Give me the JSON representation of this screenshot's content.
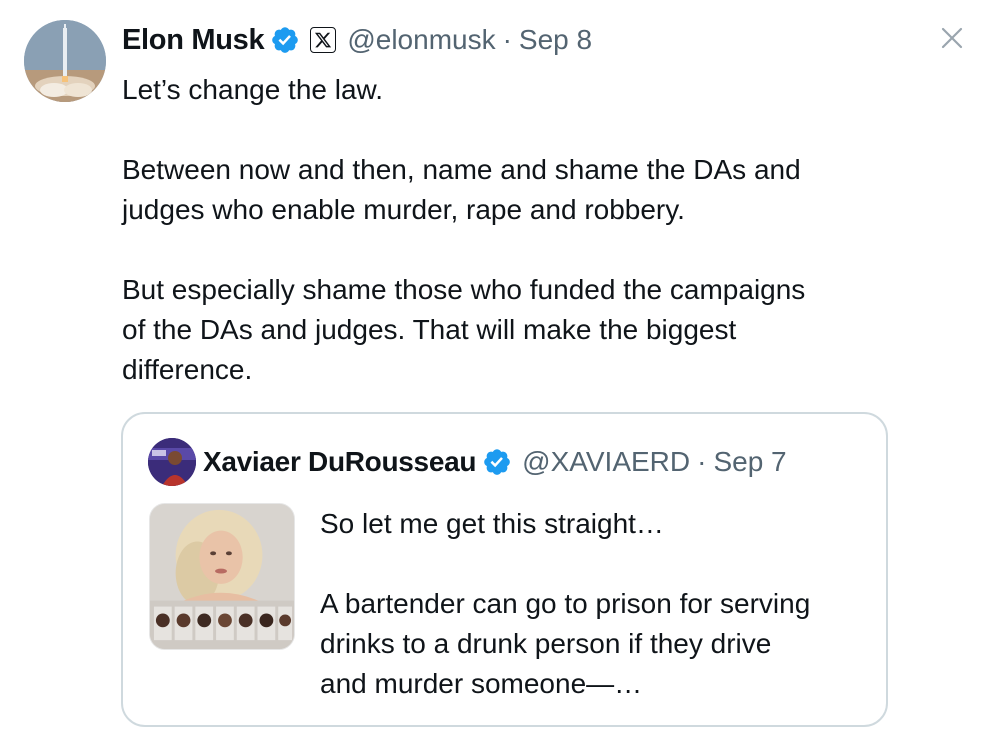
{
  "tweet": {
    "author": {
      "name": "Elon Musk",
      "handle": "@elonmusk",
      "separator": "·",
      "date": "Sep 8",
      "avatar_icon": "rocket-launch-avatar",
      "verified_icon": "verified-badge-icon",
      "affiliation_icon": "x-logo-icon"
    },
    "lines": [
      "Let’s change the law.",
      "",
      "Between now and then, name and shame the DAs and",
      "judges who enable murder, rape and robbery.",
      "",
      "But especially shame those who funded the campaigns",
      "of the DAs and judges. That will make the biggest",
      "difference."
    ],
    "close_icon": "close-icon"
  },
  "quote": {
    "author": {
      "name": "Xaviaer DuRousseau",
      "handle": "@XAVIAERD",
      "separator": "·",
      "date": "Sep 7",
      "avatar_icon": "profile-photo-avatar",
      "verified_icon": "verified-badge-icon"
    },
    "lines": [
      "So let me get this straight…",
      "",
      "A bartender can go to prison for serving",
      "drinks to a drunk person if they drive",
      "and murder someone—…"
    ],
    "media_icon": "portrait-and-mugshots-thumbnail"
  },
  "colors": {
    "text": "#0f1419",
    "secondary": "#536471",
    "verified_blue": "#1d9bf0",
    "border": "#cfd9de"
  }
}
